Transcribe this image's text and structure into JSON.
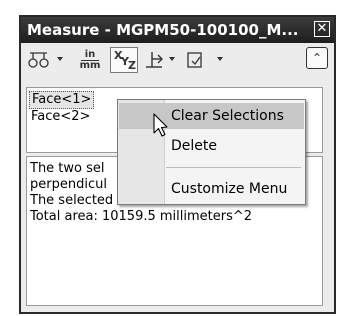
{
  "window": {
    "title": "Measure - MGPM50-100100_M...",
    "close_glyph": "✕"
  },
  "toolbar": {
    "units_top": "in",
    "units_bottom": "mm",
    "xyz_x": "X",
    "xyz_y": "Y",
    "xyz_z": "Z",
    "collapse_glyph": "⌃"
  },
  "selections": {
    "items": [
      "Face<1>",
      "Face<2>"
    ]
  },
  "results": {
    "lines": [
      "The two sel",
      "perpendicul",
      "The selected items intersect.",
      "Total area: 10159.5 millimeters^2"
    ]
  },
  "context_menu": {
    "items": [
      "Clear Selections",
      "Delete",
      "Customize Menu"
    ]
  },
  "icons": {
    "point_to_point": "point-to-point-icon",
    "units": "units-precision-icon",
    "xyz": "xyz-measure-icon",
    "projection": "projection-icon",
    "history": "measurement-history-icon",
    "collapse": "collapse-icon",
    "cursor": "mouse-pointer-icon"
  }
}
